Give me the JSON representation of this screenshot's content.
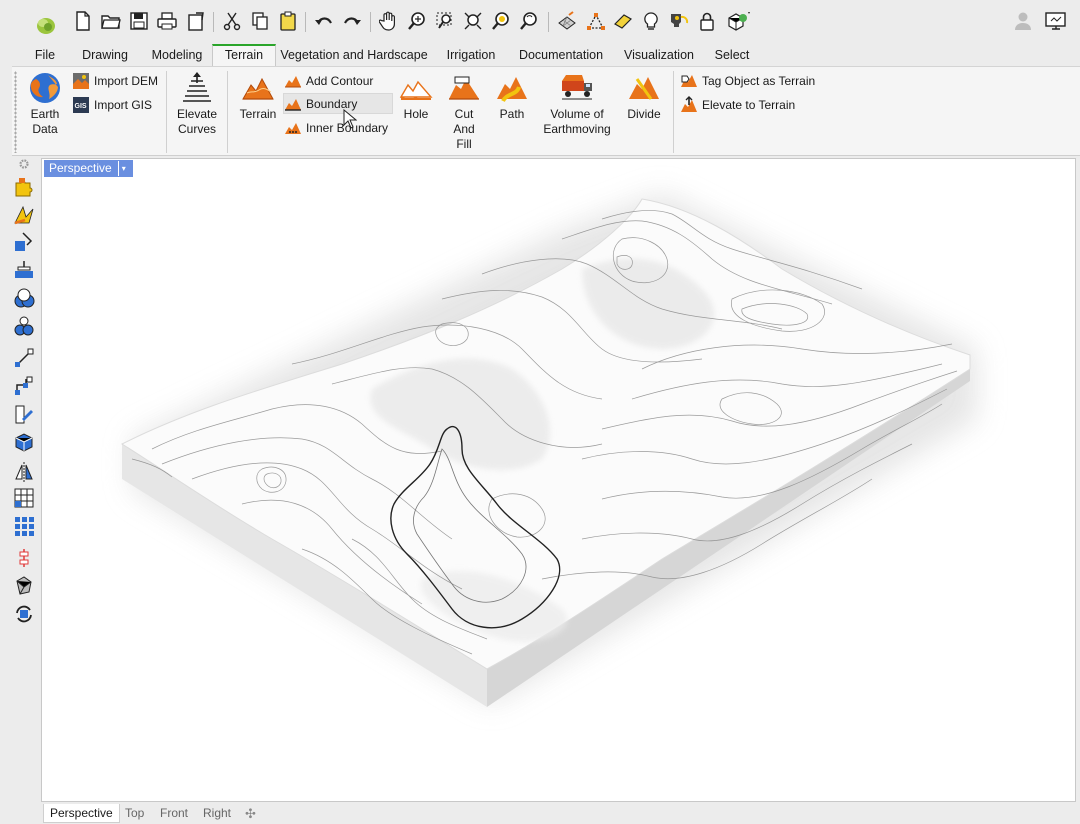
{
  "menu_tabs": [
    {
      "label": "File"
    },
    {
      "label": "Drawing"
    },
    {
      "label": "Modeling"
    },
    {
      "label": "Terrain"
    },
    {
      "label": "Vegetation and Hardscape"
    },
    {
      "label": "Irrigation"
    },
    {
      "label": "Documentation"
    },
    {
      "label": "Visualization"
    },
    {
      "label": "Select"
    }
  ],
  "active_tab": "Terrain",
  "ribbon": {
    "earth_data": {
      "label_line1": "Earth",
      "label_line2": "Data"
    },
    "import_dem": "Import DEM",
    "import_gis": "Import GIS",
    "elevate_curves": {
      "label_line1": "Elevate",
      "label_line2": "Curves"
    },
    "terrain": "Terrain",
    "add_contour": "Add Contour",
    "boundary": "Boundary",
    "inner_boundary": "Inner Boundary",
    "hole": "Hole",
    "cut_and_fill": {
      "label_line1": "Cut",
      "label_line2": "And",
      "label_line3": "Fill"
    },
    "path": "Path",
    "volume_of_earthmoving": {
      "label_line1": "Volume of",
      "label_line2": "Earthmoving"
    },
    "divide": "Divide",
    "tag_object_as_terrain": "Tag Object as Terrain",
    "elevate_to_terrain": "Elevate to Terrain"
  },
  "viewport": {
    "title": "Perspective"
  },
  "viewport_tabs": [
    {
      "label": "Perspective"
    },
    {
      "label": "Top"
    },
    {
      "label": "Front"
    },
    {
      "label": "Right"
    }
  ],
  "colors": {
    "accent_green": "#2aa52a",
    "viewport_title_bg": "#6a8fe0",
    "terrain_orange": "#e8731a",
    "icon_yellow": "#f2c40f",
    "icon_blue": "#2e6fd1"
  }
}
